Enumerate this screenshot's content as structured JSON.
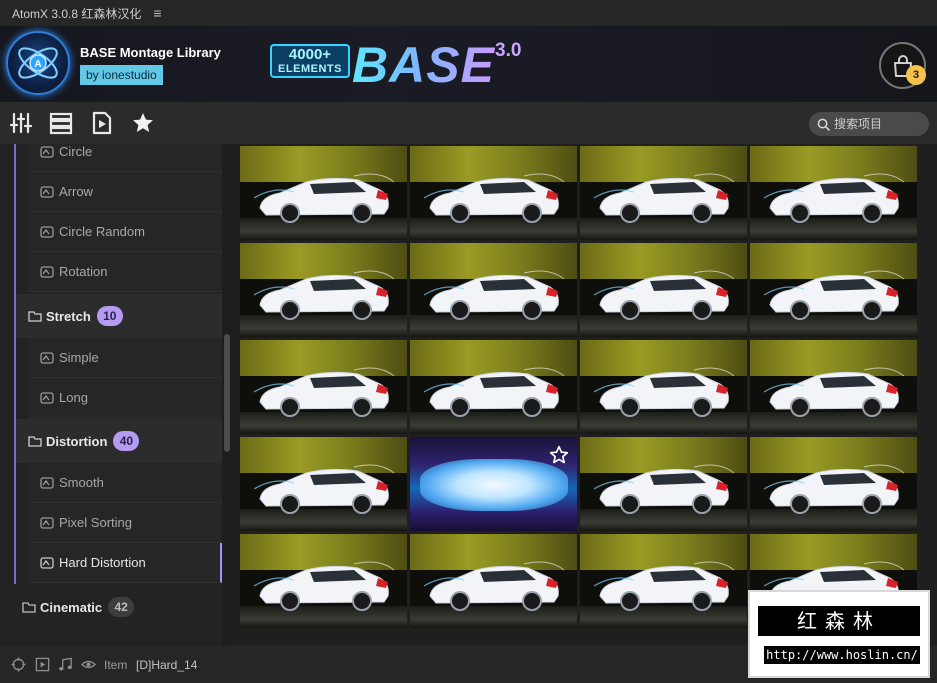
{
  "titlebar": {
    "app_title": "AtomX  3.0.8 红森林汉化",
    "menu_icon": "hamburger-menu-icon"
  },
  "banner": {
    "library_name": "BASE Montage Library",
    "author": "by ionestudio",
    "hero_count": "4000+",
    "hero_unit": "ELEMENTS",
    "hero_name": "BASE",
    "hero_version": "3.0",
    "cart_count": "3",
    "logo_icon": "atomx-atom-logo-icon",
    "cart_icon": "shopping-bag-icon"
  },
  "toolbar": {
    "icons": [
      "sliders-icon",
      "list-view-icon",
      "play-document-icon",
      "star-favorites-icon"
    ],
    "search_placeholder": "搜索项目"
  },
  "sidebar": {
    "items_top": [
      {
        "label": "Circle"
      },
      {
        "label": "Arrow"
      },
      {
        "label": "Circle Random"
      },
      {
        "label": "Rotation"
      }
    ],
    "group_stretch": {
      "label": "Stretch",
      "count": "10"
    },
    "items_stretch": [
      {
        "label": "Simple"
      },
      {
        "label": "Long"
      }
    ],
    "group_distortion": {
      "label": "Distortion",
      "count": "40"
    },
    "items_distortion": [
      {
        "label": "Smooth"
      },
      {
        "label": "Pixel Sorting"
      },
      {
        "label": "Hard Distortion",
        "active": true
      }
    ],
    "group_cinematic": {
      "label": "Cinematic",
      "count": "42"
    }
  },
  "grid": {
    "rows": 5,
    "cols": 4,
    "highlighted_tile": {
      "row": 3,
      "col": 1
    }
  },
  "statusbar": {
    "icons": [
      "target-icon",
      "video-icon",
      "music-note-icon",
      "eye-icon"
    ],
    "item_label": "Item",
    "item_value": "[D]Hard_14"
  },
  "watermark": {
    "title": "红森林",
    "url": "http://www.hoslin.cn/"
  },
  "colors": {
    "accent": "#b49cf2",
    "rail": "#7c6bc9",
    "badge": "#f6c24a",
    "author_bg": "#63c7e8"
  }
}
